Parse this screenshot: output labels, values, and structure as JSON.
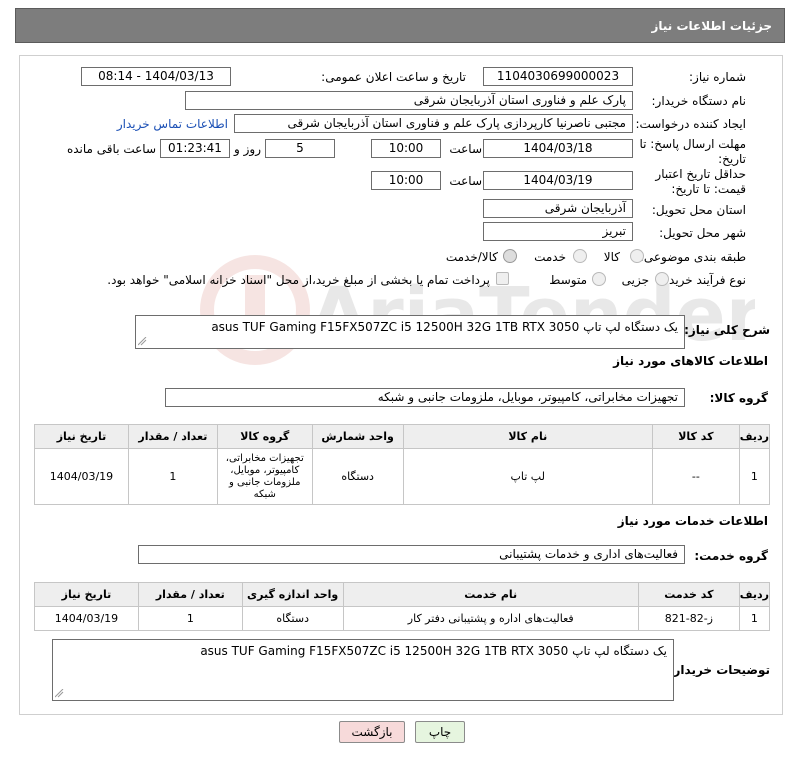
{
  "header": {
    "title": "جزئیات اطلاعات نیاز"
  },
  "form": {
    "need_number_label": "شماره نیاز:",
    "need_number": "1104030699000023",
    "announce_label": "تاریخ و ساعت اعلان عمومی:",
    "announce_value": "1404/03/13 - 08:14",
    "buyer_org_label": "نام دستگاه خریدار:",
    "buyer_org": "پارک علم و فناوری استان آذربایجان شرقی",
    "creator_label": "ایجاد کننده درخواست:",
    "creator": "مجتبی ناصرنیا کارپردازی پارک علم و فناوری استان آذربایجان شرقی",
    "contact_link": "اطلاعات تماس خریدار",
    "deadline_label": "مهلت ارسال پاسخ: تا تاریخ:",
    "deadline_date": "1404/03/18",
    "time_label": "ساعت",
    "deadline_time": "10:00",
    "days_value": "5",
    "days_label": "روز و",
    "remaining_value": "01:23:41",
    "remaining_label": "ساعت باقی مانده",
    "min_validity_label": "حداقل تاریخ اعتبار قیمت: تا تاریخ:",
    "validity_date": "1404/03/19",
    "validity_time": "10:00",
    "province_label": "استان محل تحویل:",
    "province": "آذربایجان شرقی",
    "city_label": "شهر محل تحویل:",
    "city": "تبریز",
    "category_label": "طبقه بندی موضوعی:",
    "category_options": [
      "کالا",
      "خدمت",
      "کالا/خدمت"
    ],
    "process_label": "نوع فرآیند خرید :",
    "process_options": [
      "جزیی",
      "متوسط"
    ],
    "payment_note": "پرداخت تمام یا بخشی از مبلغ خرید،از محل \"اسناد خزانه اسلامی\" خواهد بود."
  },
  "description": {
    "label": "شرح کلی نیاز:",
    "text": "asus TUF Gaming F15FX507ZC i5 12500H 32G 1TB RTX 3050 یک دستگاه لپ تاپ"
  },
  "goods": {
    "section_title": "اطلاعات کالاهای مورد نیاز",
    "group_label": "گروه کالا:",
    "group_value": "تجهیزات مخابراتی، کامپیوتر، موبایل، ملزومات جانبی و شبکه",
    "columns": [
      "ردیف",
      "کد کالا",
      "نام کالا",
      "واحد شمارش",
      "گروه کالا",
      "تعداد / مقدار",
      "تاریخ نیاز"
    ],
    "rows": [
      {
        "row": "1",
        "code": "--",
        "name": "لپ تاپ",
        "unit": "دستگاه",
        "group": "تجهیزات مخابراتی، کامپیوتر، موبایل، ملزومات جانبی و شبکه",
        "qty": "1",
        "date": "1404/03/19"
      }
    ]
  },
  "services": {
    "section_title": "اطلاعات خدمات مورد نیاز",
    "group_label": "گروه خدمت:",
    "group_value": "فعالیت‌های اداری و خدمات پشتیبانی",
    "columns": [
      "ردیف",
      "کد خدمت",
      "نام خدمت",
      "واحد اندازه گیری",
      "تعداد / مقدار",
      "تاریخ نیاز"
    ],
    "rows": [
      {
        "row": "1",
        "code": "ز-82-821",
        "name": "فعالیت‌های اداره و پشتیبانی دفتر کار",
        "unit": "دستگاه",
        "qty": "1",
        "date": "1404/03/19"
      }
    ]
  },
  "buyer_notes": {
    "label": "توضیحات خریدار:",
    "text": "asus TUF Gaming F15FX507ZC i5 12500H 32G 1TB RTX 3050 یک دستگاه لپ تاپ"
  },
  "buttons": {
    "print": "چاپ",
    "back": "بازگشت"
  },
  "watermark": {
    "text": "AriaTender.neT"
  }
}
